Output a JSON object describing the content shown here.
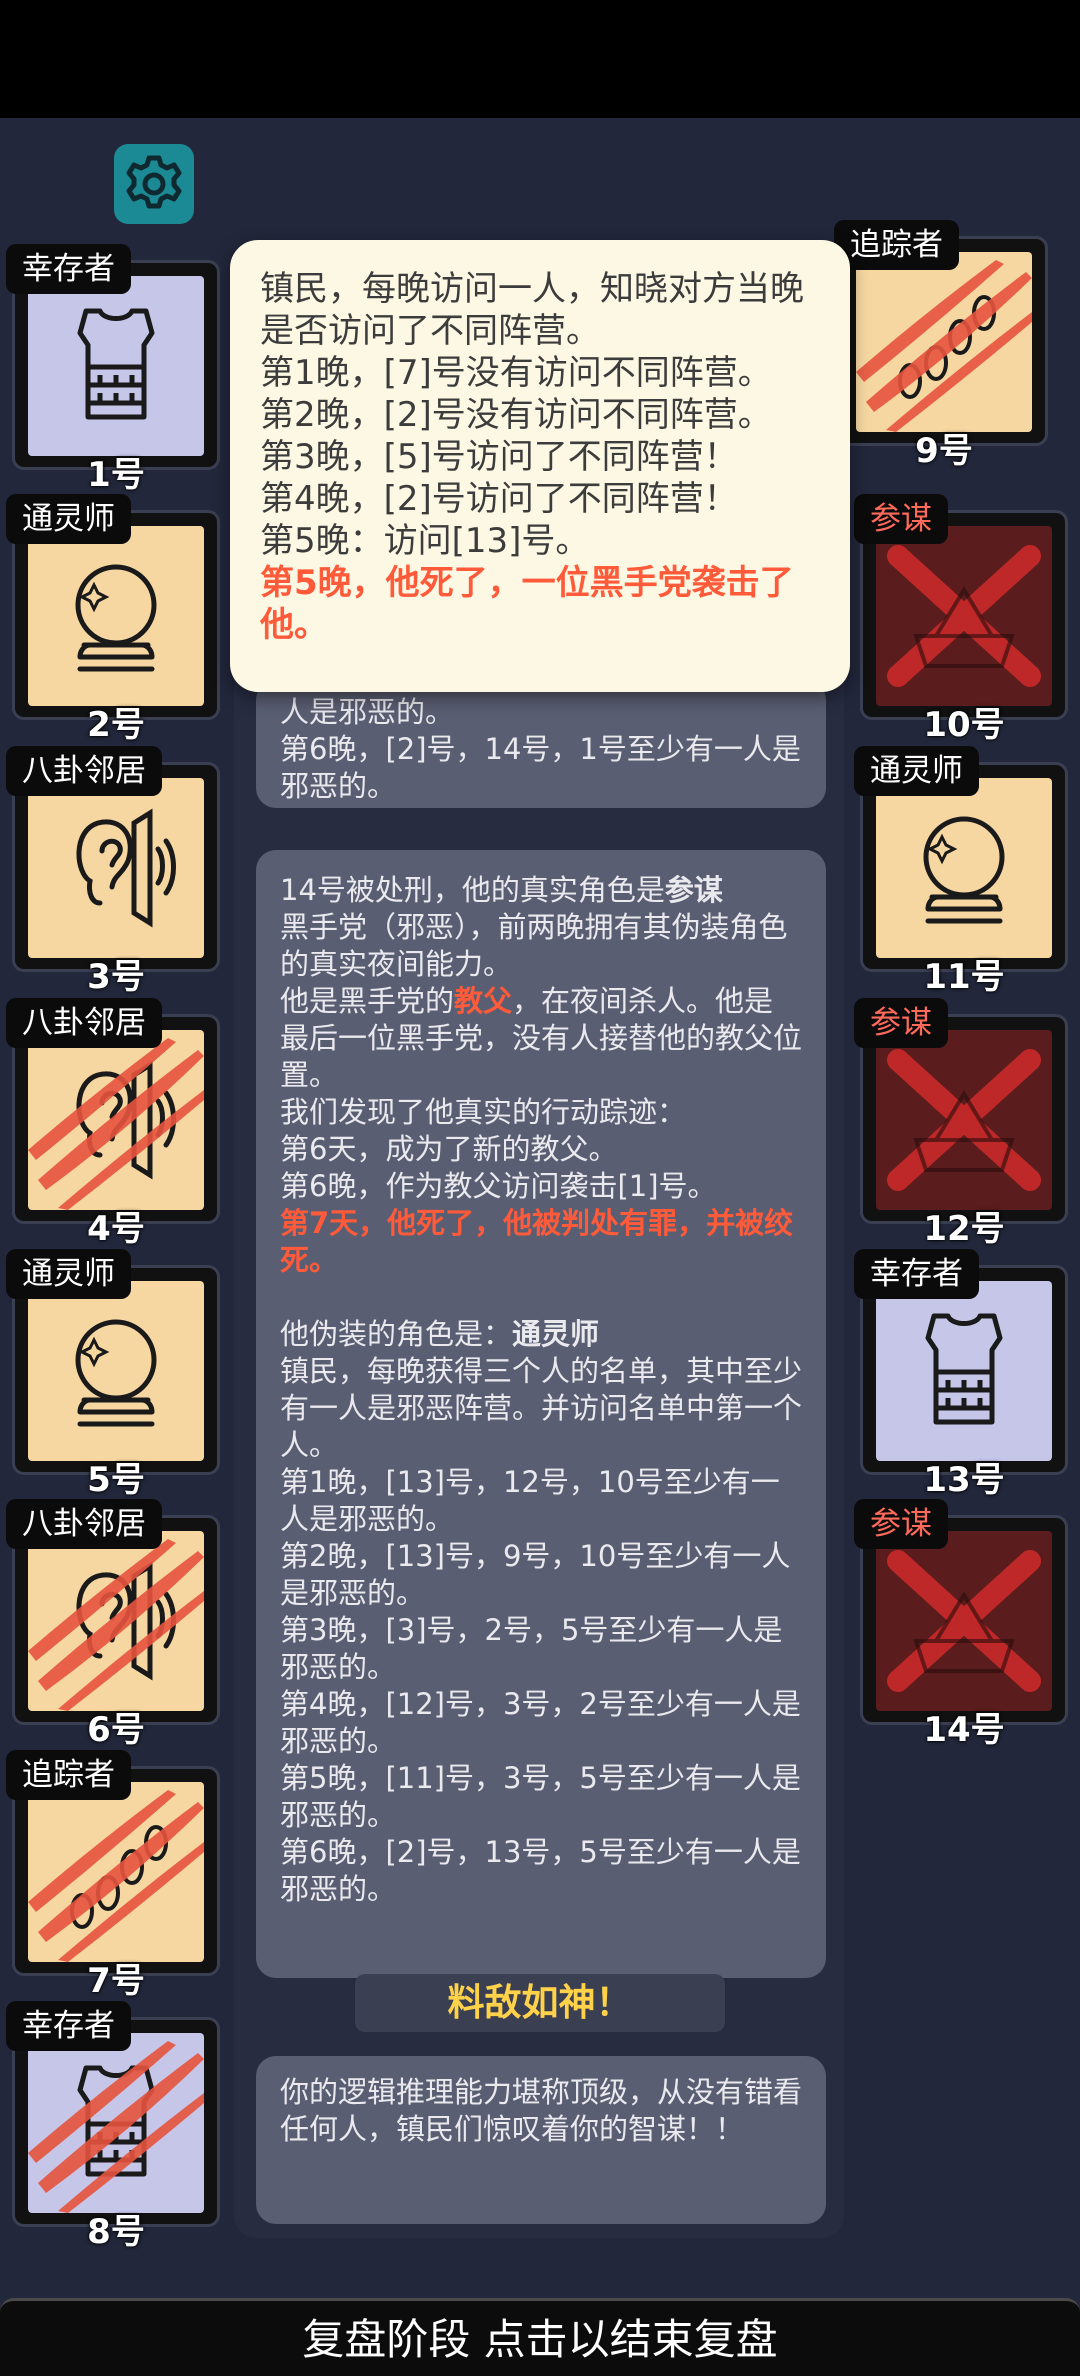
{
  "players": [
    {
      "role": "幸存者",
      "num": "1号",
      "side": "left",
      "color": "lav",
      "icon": "vest",
      "scratch": false
    },
    {
      "role": "通灵师",
      "num": "2号",
      "side": "left",
      "color": "beige",
      "icon": "crystal-ball",
      "scratch": false
    },
    {
      "role": "八卦邻居",
      "num": "3号",
      "side": "left",
      "color": "beige",
      "icon": "ear",
      "scratch": false
    },
    {
      "role": "八卦邻居",
      "num": "4号",
      "side": "left",
      "color": "beige",
      "icon": "ear",
      "scratch": true
    },
    {
      "role": "通灵师",
      "num": "5号",
      "side": "left",
      "color": "beige",
      "icon": "crystal-ball",
      "scratch": false
    },
    {
      "role": "八卦邻居",
      "num": "6号",
      "side": "left",
      "color": "beige",
      "icon": "ear",
      "scratch": true
    },
    {
      "role": "追踪者",
      "num": "7号",
      "side": "left",
      "color": "beige",
      "icon": "footprints",
      "scratch": true
    },
    {
      "role": "幸存者",
      "num": "8号",
      "side": "left",
      "color": "lav",
      "icon": "vest",
      "scratch": true
    },
    {
      "role": "追踪者",
      "num": "9号",
      "side": "right",
      "color": "beige",
      "icon": "footprints",
      "scratch": true
    },
    {
      "role": "参谋",
      "num": "10号",
      "side": "right",
      "color": "dead",
      "icon": "x-mark",
      "scratch": false
    },
    {
      "role": "通灵师",
      "num": "11号",
      "side": "right",
      "color": "beige",
      "icon": "crystal-ball",
      "scratch": false
    },
    {
      "role": "参谋",
      "num": "12号",
      "side": "right",
      "color": "dead",
      "icon": "x-mark",
      "scratch": false
    },
    {
      "role": "幸存者",
      "num": "13号",
      "side": "right",
      "color": "lav",
      "icon": "vest",
      "scratch": false
    },
    {
      "role": "参谋",
      "num": "14号",
      "side": "right",
      "color": "dead",
      "icon": "x-mark",
      "scratch": false
    }
  ],
  "popup": {
    "text": "镇民，每晚访问一人，知晓对方当晚是否访问了不同阵营。\n第1晚，[7]号没有访问不同阵营。\n第2晚，[2]号没有访问不同阵营。\n第3晚，[5]号访问了不同阵营！\n第4晚，[2]号访问了不同阵营！\n第5晚：访问[13]号。",
    "death": "第5晚，他死了，一位黑手党袭击了他。"
  },
  "log1": {
    "text": "人是邪恶的。\n第6晚，[2]号，14号，1号至少有一人是邪恶的。"
  },
  "log2": {
    "l1a": "14号被处刑，他的真实角色是",
    "l1b": "参谋",
    "l2": "黑手党（邪恶），前两晚拥有其伪装角色的真实夜间能力。",
    "l3a": "他是黑手党的",
    "l3b": "教父",
    "l3c": "，在夜间杀人。他是最后一位黑手党，没有人接替他的教父位置。",
    "l4": "我们发现了他真实的行动踪迹：\n第6天，成为了新的教父。\n第6晚，作为教父访问袭击[1]号。",
    "death": "第7天，他死了，他被判处有罪，并被绞死。",
    "l5a": "他伪装的角色是：",
    "l5b": "通灵师",
    "l6": "镇民，每晚获得三个人的名单，其中至少有一人是邪恶阵营。并访问名单中第一个人。\n第1晚，[13]号，12号，10号至少有一人是邪恶的。\n第2晚，[13]号，9号，10号至少有一人是邪恶的。\n第3晚，[3]号，2号，5号至少有一人是邪恶的。\n第4晚，[12]号，3号，2号至少有一人是邪恶的。\n第5晚，[11]号，3号，5号至少有一人是邪恶的。\n第6晚，[2]号，13号，5号至少有一人是邪恶的。"
  },
  "result_title": "料敌如神！",
  "result_text": "你的逻辑推理能力堪称顶级，从没有错看任何人，镇民们惊叹着你的智谋！！",
  "bottom": "复盘阶段 点击以结束复盘",
  "colors": {
    "accent": "#1c8a95",
    "death_red": "#ff5a3a",
    "gold": "#ffd24a"
  }
}
